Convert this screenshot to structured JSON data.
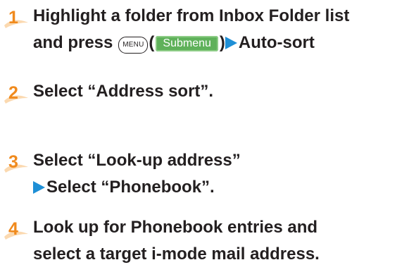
{
  "colors": {
    "step_number": "#f08a1d",
    "arrow": "#1e8fd6",
    "submenu_button": "#5fb15a",
    "text": "#231f20"
  },
  "steps": [
    {
      "number": "1",
      "line1": "Highlight a folder from Inbox Folder list",
      "line2_prefix": "and press",
      "menu_key": "MENU",
      "paren_open": "(",
      "submenu_label": "Submenu",
      "paren_close": ")",
      "line2_suffix": "Auto-sort"
    },
    {
      "number": "2",
      "line1": "Select “Address sort”."
    },
    {
      "number": "3",
      "line1": "Select “Look-up address”",
      "line2": "Select “Phonebook”."
    },
    {
      "number": "4",
      "line1": "Look up for Phonebook entries and",
      "line2": "select a target i-mode mail address."
    }
  ]
}
